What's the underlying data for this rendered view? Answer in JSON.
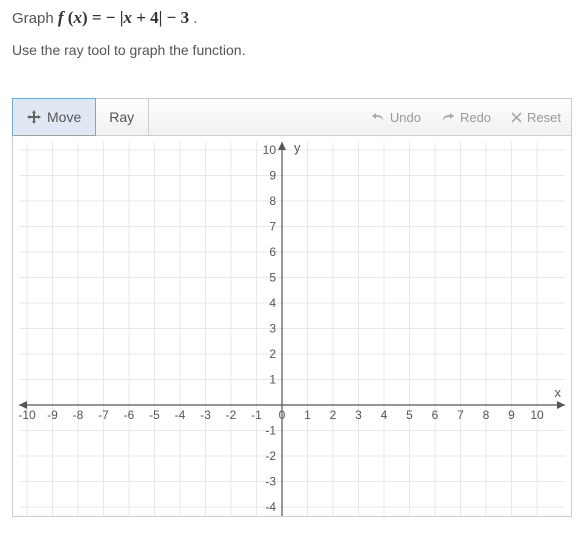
{
  "prompt": {
    "prefix": "Graph ",
    "equation_display": "f (x) = − |x + 4| − 3",
    "suffix": " .",
    "instruction": "Use the ray tool to graph the function."
  },
  "toolbar": {
    "tools": [
      {
        "name": "move",
        "label": "Move",
        "active": true
      },
      {
        "name": "ray",
        "label": "Ray",
        "active": false
      }
    ],
    "actions": [
      {
        "name": "undo",
        "label": "Undo",
        "icon": "undo-icon"
      },
      {
        "name": "redo",
        "label": "Redo",
        "icon": "redo-icon"
      },
      {
        "name": "reset",
        "label": "Reset",
        "icon": "reset-icon"
      }
    ]
  },
  "chart_data": {
    "type": "scatter",
    "title": "",
    "xlabel": "x",
    "ylabel": "y",
    "xlim": [
      -10,
      10
    ],
    "ylim": [
      -4,
      10
    ],
    "x_ticks": [
      -10,
      -9,
      -8,
      -7,
      -6,
      -5,
      -4,
      -3,
      -2,
      -1,
      0,
      1,
      2,
      3,
      4,
      5,
      6,
      7,
      8,
      9,
      10
    ],
    "y_ticks": [
      -4,
      -3,
      -2,
      -1,
      0,
      1,
      2,
      3,
      4,
      5,
      6,
      7,
      8,
      9,
      10
    ],
    "series": [
      {
        "name": "f(x) = -|x+4| - 3",
        "values": []
      }
    ],
    "grid": true
  }
}
